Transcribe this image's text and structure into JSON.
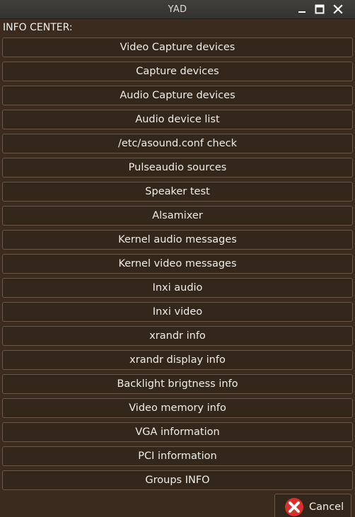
{
  "window": {
    "title": "YAD",
    "controls": [
      "minimize-icon",
      "maximize-icon",
      "close-icon"
    ]
  },
  "header": {
    "label": "INFO CENTER:"
  },
  "buttons": [
    "Video Capture devices",
    "Capture devices",
    "Audio Capture devices",
    "Audio device list",
    "/etc/asound.conf check",
    "Pulseaudio sources",
    "Speaker test",
    "Alsamixer",
    "Kernel audio messages",
    "Kernel video messages",
    "Inxi audio",
    "Inxi video",
    "xrandr info",
    "xrandr display info",
    "Backlight brigtness info",
    "Video memory info",
    "VGA information",
    "PCI information",
    "Groups INFO"
  ],
  "footer": {
    "cancel_label": "Cancel",
    "cancel_icon": "cancel-x-icon"
  },
  "colors": {
    "background": "#3b2a1e",
    "button_bg": "#33261b",
    "button_border": "#6a5747",
    "text": "#f1eee9",
    "cancel_icon_red": "#d8302d"
  }
}
